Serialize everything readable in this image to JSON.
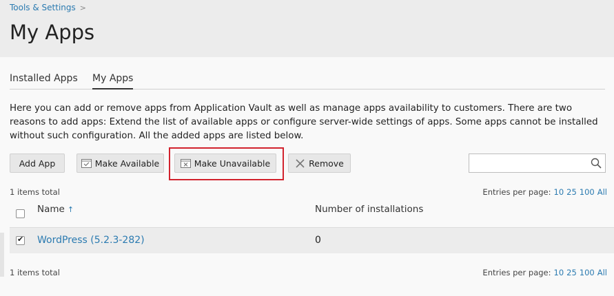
{
  "header": {
    "breadcrumb": "Tools & Settings",
    "title": "My Apps"
  },
  "tabs": [
    {
      "label": "Installed Apps",
      "active": false
    },
    {
      "label": "My Apps",
      "active": true
    }
  ],
  "description": "Here you can add or remove apps from Application Vault as well as manage apps availability to customers. There are two reasons to add apps: Extend the list of available apps or configure server-wide settings of apps. Some apps cannot be installed without such configuration. All the added apps are listed below.",
  "toolbar": {
    "add_label": "Add App",
    "make_available_label": "Make Available",
    "make_unavailable_label": "Make Unavailable",
    "remove_label": "Remove",
    "search_placeholder": "",
    "search_value": ""
  },
  "list_info": {
    "total_top": "1 items total",
    "total_bottom": "1 items total",
    "entries_label": "Entries per page:",
    "entries_options": [
      "10",
      "25",
      "100",
      "All"
    ]
  },
  "table": {
    "columns": [
      "Name",
      "Number of installations"
    ],
    "sort_indicator": "↑",
    "rows": [
      {
        "name": "WordPress (5.2.3-282)",
        "installations": "0",
        "checked": true
      }
    ]
  },
  "colors": {
    "accent_link": "#2a7ab0",
    "highlight_border": "#d2222d",
    "header_bg": "#ececec"
  }
}
